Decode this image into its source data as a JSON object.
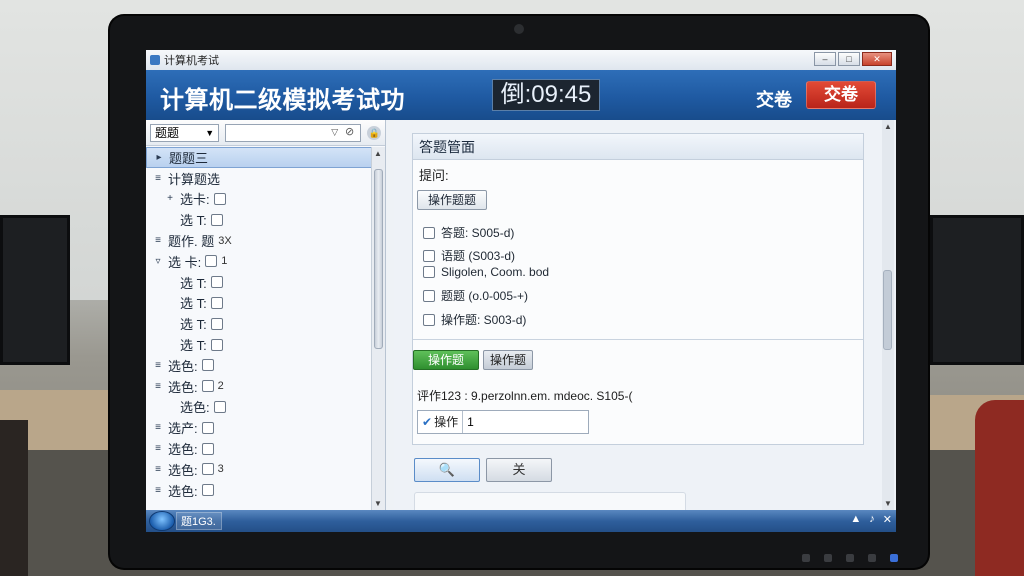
{
  "window": {
    "title": "计算机考试"
  },
  "header": {
    "app_title": "计算机二级模拟考试功",
    "timer": "倒:09:45",
    "submit_text": "交卷",
    "submit_button": "交卷"
  },
  "left_panel": {
    "filter_select": "题题",
    "search_placeholder": "",
    "tree_items": [
      {
        "expander": "▸",
        "label": "题题三",
        "tag": "",
        "has_checkbox": false
      },
      {
        "expander": "≡",
        "label": "计算题选",
        "tag": "",
        "has_checkbox": false
      },
      {
        "expander": "+",
        "label": "选卡:",
        "tag": "",
        "has_checkbox": true
      },
      {
        "expander": "",
        "label": "选 T:",
        "tag": "",
        "has_checkbox": true
      },
      {
        "expander": "≡",
        "label": "题作. 题",
        "tag": "3X",
        "has_checkbox": false
      },
      {
        "expander": "▿",
        "label": "选 卡:",
        "tag": "1",
        "has_checkbox": true
      },
      {
        "expander": "",
        "label": "选 T:",
        "tag": "",
        "has_checkbox": true
      },
      {
        "expander": "",
        "label": "选 T:",
        "tag": "",
        "has_checkbox": true
      },
      {
        "expander": "",
        "label": "选 T:",
        "tag": "",
        "has_checkbox": true
      },
      {
        "expander": "",
        "label": "选 T:",
        "tag": "",
        "has_checkbox": true
      },
      {
        "expander": "≡",
        "label": "选色:",
        "tag": "",
        "has_checkbox": true
      },
      {
        "expander": "≡",
        "label": "选色:",
        "tag": "2",
        "has_checkbox": true
      },
      {
        "expander": "",
        "label": "选色:",
        "tag": "",
        "has_checkbox": true
      },
      {
        "expander": "≡",
        "label": "选产:",
        "tag": "",
        "has_checkbox": true
      },
      {
        "expander": "≡",
        "label": "选色:",
        "tag": "",
        "has_checkbox": true
      },
      {
        "expander": "≡",
        "label": "选色:",
        "tag": "3",
        "has_checkbox": true
      },
      {
        "expander": "≡",
        "label": "选色:",
        "tag": "",
        "has_checkbox": true
      }
    ]
  },
  "right_panel": {
    "card_title": "答题管面",
    "hint": "提问:",
    "operate_button": "操作题题",
    "options": [
      {
        "label": "答题:  S005-d)"
      },
      {
        "label": "语题 (S003-d)"
      },
      {
        "label": "Sligolen, Coom. bod"
      },
      {
        "label": "题题 (o.0-005-+)"
      },
      {
        "label": "操作题: S003-d)"
      }
    ],
    "tab_active": "操作题",
    "tab_inactive": "操作题",
    "path_line": "评作123 : 9.perzolnn.em. mdeoc. S105-(",
    "answer_label": "操作",
    "answer_value": "1",
    "search_button_glyph": "🔍",
    "close_button_glyph": "关"
  },
  "taskbar": {
    "task_label": "题1G3.",
    "tray_icons": [
      "network-icon",
      "sound-icon",
      "close-icon"
    ]
  },
  "colors": {
    "header_blue": "#1f5aa2",
    "submit_red": "#c8301f",
    "tab_green": "#3a9a36"
  }
}
